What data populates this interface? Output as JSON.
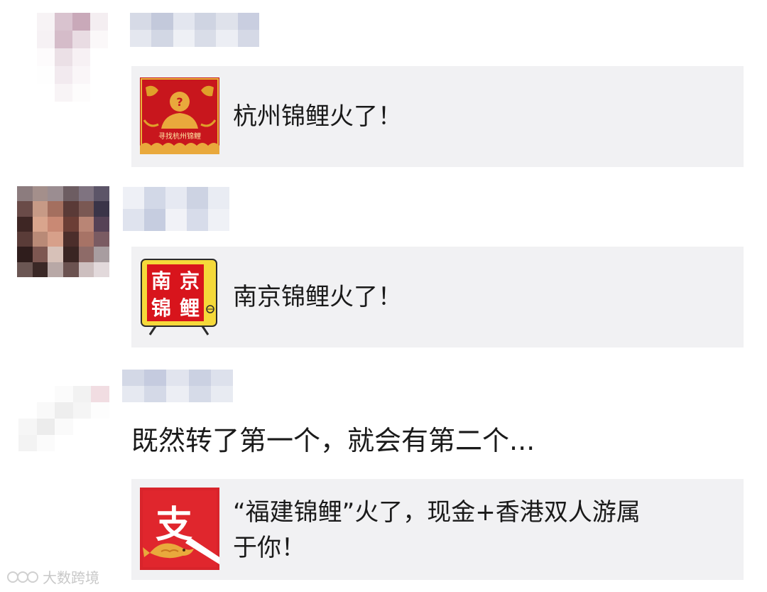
{
  "messages": [
    {
      "type": "link-card",
      "card_title": "杭州锦鲤火了！",
      "thumb_caption": "寻找杭州锦鲤"
    },
    {
      "type": "link-card",
      "card_title": "南京锦鲤火了！",
      "thumb_chars": [
        "南",
        "京",
        "锦",
        "鲤"
      ]
    },
    {
      "type": "text-and-card",
      "text": "既然转了第一个，就会有第二个...",
      "card_title_line1": "“福建锦鲤”火了，现金+香港双人游属",
      "card_title_line2": "于你！",
      "thumb_char": "支"
    }
  ],
  "watermark": {
    "text": "大数跨境"
  },
  "colors": {
    "card_bg": "#f1f1f3",
    "red": "#c8161d",
    "yellow": "#f5d93a",
    "gold": "#e0a02a"
  }
}
